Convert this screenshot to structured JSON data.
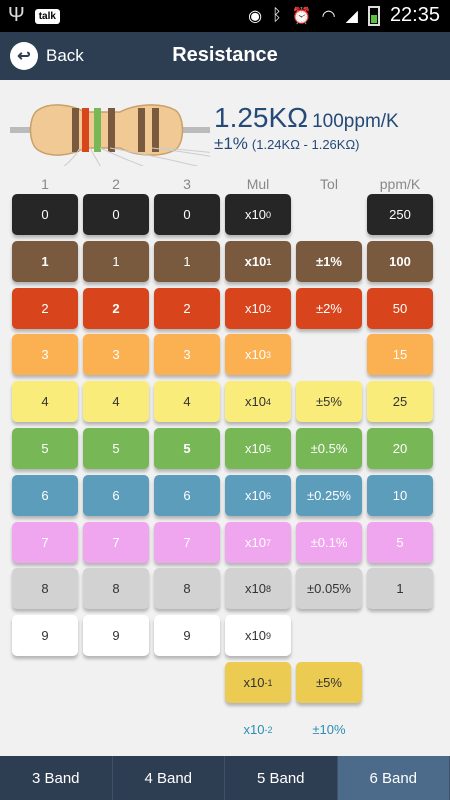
{
  "status_bar": {
    "time": "22:35",
    "talk_label": "talk"
  },
  "header": {
    "back_label": "Back",
    "title": "Resistance"
  },
  "readout": {
    "value": "1.25KΩ",
    "ppm": "100ppm/K",
    "tolerance": "±1%",
    "range": "(1.24KΩ - 1.26KΩ)"
  },
  "column_headers": [
    "1",
    "2",
    "3",
    "Mul",
    "Tol",
    "ppm/K"
  ],
  "digit_rows": [
    {
      "label": "0",
      "bg": "#262626",
      "fg": "#ffffff"
    },
    {
      "label": "1",
      "bg": "#7a5a3e",
      "fg": "#ffffff"
    },
    {
      "label": "2",
      "bg": "#d8451c",
      "fg": "#ffffff"
    },
    {
      "label": "3",
      "bg": "#fbb052",
      "fg": "#ffffff"
    },
    {
      "label": "4",
      "bg": "#f9ec7b",
      "fg": "#333333"
    },
    {
      "label": "5",
      "bg": "#78b756",
      "fg": "#ffffff"
    },
    {
      "label": "6",
      "bg": "#5c9dbc",
      "fg": "#ffffff"
    },
    {
      "label": "7",
      "bg": "#f0a6ef",
      "fg": "#ffffff"
    },
    {
      "label": "8",
      "bg": "#d2d2d2",
      "fg": "#333333"
    },
    {
      "label": "9",
      "bg": "#ffffff",
      "fg": "#333333"
    }
  ],
  "selected": {
    "band1": "1",
    "band2": "2",
    "band3": "5"
  },
  "multipliers": [
    {
      "base": "x10",
      "exp": "0",
      "bg": "#262626",
      "fg": "#ffffff"
    },
    {
      "base": "x10",
      "exp": "1",
      "bg": "#7a5a3e",
      "fg": "#ffffff",
      "selected": true
    },
    {
      "base": "x10",
      "exp": "2",
      "bg": "#d8451c",
      "fg": "#ffffff"
    },
    {
      "base": "x10",
      "exp": "3",
      "bg": "#fbb052",
      "fg": "#ffffff"
    },
    {
      "base": "x10",
      "exp": "4",
      "bg": "#f9ec7b",
      "fg": "#333333"
    },
    {
      "base": "x10",
      "exp": "5",
      "bg": "#78b756",
      "fg": "#ffffff"
    },
    {
      "base": "x10",
      "exp": "6",
      "bg": "#5c9dbc",
      "fg": "#ffffff"
    },
    {
      "base": "x10",
      "exp": "7",
      "bg": "#f0a6ef",
      "fg": "#ffffff"
    },
    {
      "base": "x10",
      "exp": "8",
      "bg": "#d2d2d2",
      "fg": "#333333"
    },
    {
      "base": "x10",
      "exp": "9",
      "bg": "#ffffff",
      "fg": "#333333"
    },
    {
      "base": "x10",
      "exp": "-1",
      "bg": "#ebcb52",
      "fg": "#333333"
    },
    {
      "base": "x10",
      "exp": "-2",
      "bg": "#eeeeee",
      "fg": "#2a8fb0",
      "plain": true
    }
  ],
  "tolerances": [
    {
      "label": "",
      "row": 0
    },
    {
      "label": "±1%",
      "row": 1,
      "bg": "#7a5a3e",
      "fg": "#ffffff",
      "selected": true
    },
    {
      "label": "±2%",
      "row": 2,
      "bg": "#d8451c",
      "fg": "#ffffff"
    },
    {
      "label": "±5%",
      "row": 4,
      "bg": "#f9ec7b",
      "fg": "#333333"
    },
    {
      "label": "±0.5%",
      "row": 5,
      "bg": "#78b756",
      "fg": "#ffffff"
    },
    {
      "label": "±0.25%",
      "row": 6,
      "bg": "#5c9dbc",
      "fg": "#ffffff"
    },
    {
      "label": "±0.1%",
      "row": 7,
      "bg": "#f0a6ef",
      "fg": "#ffffff"
    },
    {
      "label": "±0.05%",
      "row": 8,
      "bg": "#d2d2d2",
      "fg": "#333333"
    },
    {
      "label": "±5%",
      "row": 10,
      "bg": "#ebcb52",
      "fg": "#333333"
    },
    {
      "label": "±10%",
      "row": 11,
      "bg": "#eeeeee",
      "fg": "#2a8fb0",
      "plain": true
    }
  ],
  "ppm": [
    {
      "label": "250",
      "row": 0,
      "bg": "#262626",
      "fg": "#ffffff"
    },
    {
      "label": "100",
      "row": 1,
      "bg": "#7a5a3e",
      "fg": "#ffffff",
      "selected": true
    },
    {
      "label": "50",
      "row": 2,
      "bg": "#d8451c",
      "fg": "#ffffff"
    },
    {
      "label": "15",
      "row": 3,
      "bg": "#fbb052",
      "fg": "#ffffff"
    },
    {
      "label": "25",
      "row": 4,
      "bg": "#f9ec7b",
      "fg": "#333333"
    },
    {
      "label": "20",
      "row": 5,
      "bg": "#78b756",
      "fg": "#ffffff"
    },
    {
      "label": "10",
      "row": 6,
      "bg": "#5c9dbc",
      "fg": "#ffffff"
    },
    {
      "label": "5",
      "row": 7,
      "bg": "#f0a6ef",
      "fg": "#ffffff"
    },
    {
      "label": "1",
      "row": 8,
      "bg": "#d2d2d2",
      "fg": "#333333"
    }
  ],
  "resistor_bands": [
    "#7a5a3e",
    "#d8451c",
    "#78b756",
    "#7a5a3e",
    "#7a5a3e",
    "#7a5a3e"
  ],
  "tabs": [
    {
      "label": "3 Band",
      "active": false
    },
    {
      "label": "4 Band",
      "active": false
    },
    {
      "label": "5 Band",
      "active": false
    },
    {
      "label": "6 Band",
      "active": true
    }
  ]
}
